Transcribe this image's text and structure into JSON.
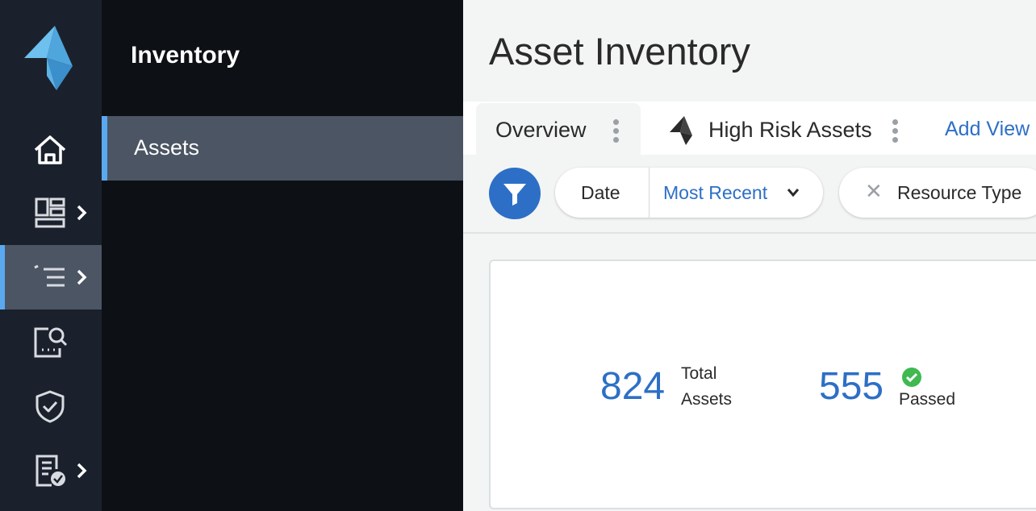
{
  "sidebar": {
    "logo": "brand-logo",
    "items": [
      {
        "icon": "home-icon",
        "active": false,
        "has_submenu": false
      },
      {
        "icon": "dashboard-icon",
        "active": false,
        "has_submenu": true
      },
      {
        "icon": "inventory-list-icon",
        "active": true,
        "has_submenu": true
      },
      {
        "icon": "search-findings-icon",
        "active": false,
        "has_submenu": false
      },
      {
        "icon": "shield-check-icon",
        "active": false,
        "has_submenu": false
      },
      {
        "icon": "report-check-icon",
        "active": false,
        "has_submenu": true
      }
    ]
  },
  "subnav": {
    "title": "Inventory",
    "items": [
      {
        "label": "Assets",
        "active": true
      }
    ]
  },
  "main": {
    "title": "Asset Inventory",
    "tabs": [
      {
        "label": "Overview",
        "active": true
      },
      {
        "label": "High Risk Assets",
        "active": false,
        "icon": "brand-icon"
      }
    ],
    "add_view_label": "Add View",
    "filters": {
      "date_label": "Date",
      "date_value": "Most Recent",
      "resource_label": "Resource Type"
    },
    "stats": [
      {
        "value": "824",
        "label_line1": "Total",
        "label_line2": "Assets"
      },
      {
        "value": "555",
        "label_line1": "Passed",
        "status_icon": "check-circle-icon"
      }
    ]
  },
  "colors": {
    "accent": "#2d6fc6",
    "active_indicator": "#5aa9f0",
    "rail_bg": "#1b212c",
    "subnav_bg": "#0d1015",
    "success": "#3fb950"
  }
}
